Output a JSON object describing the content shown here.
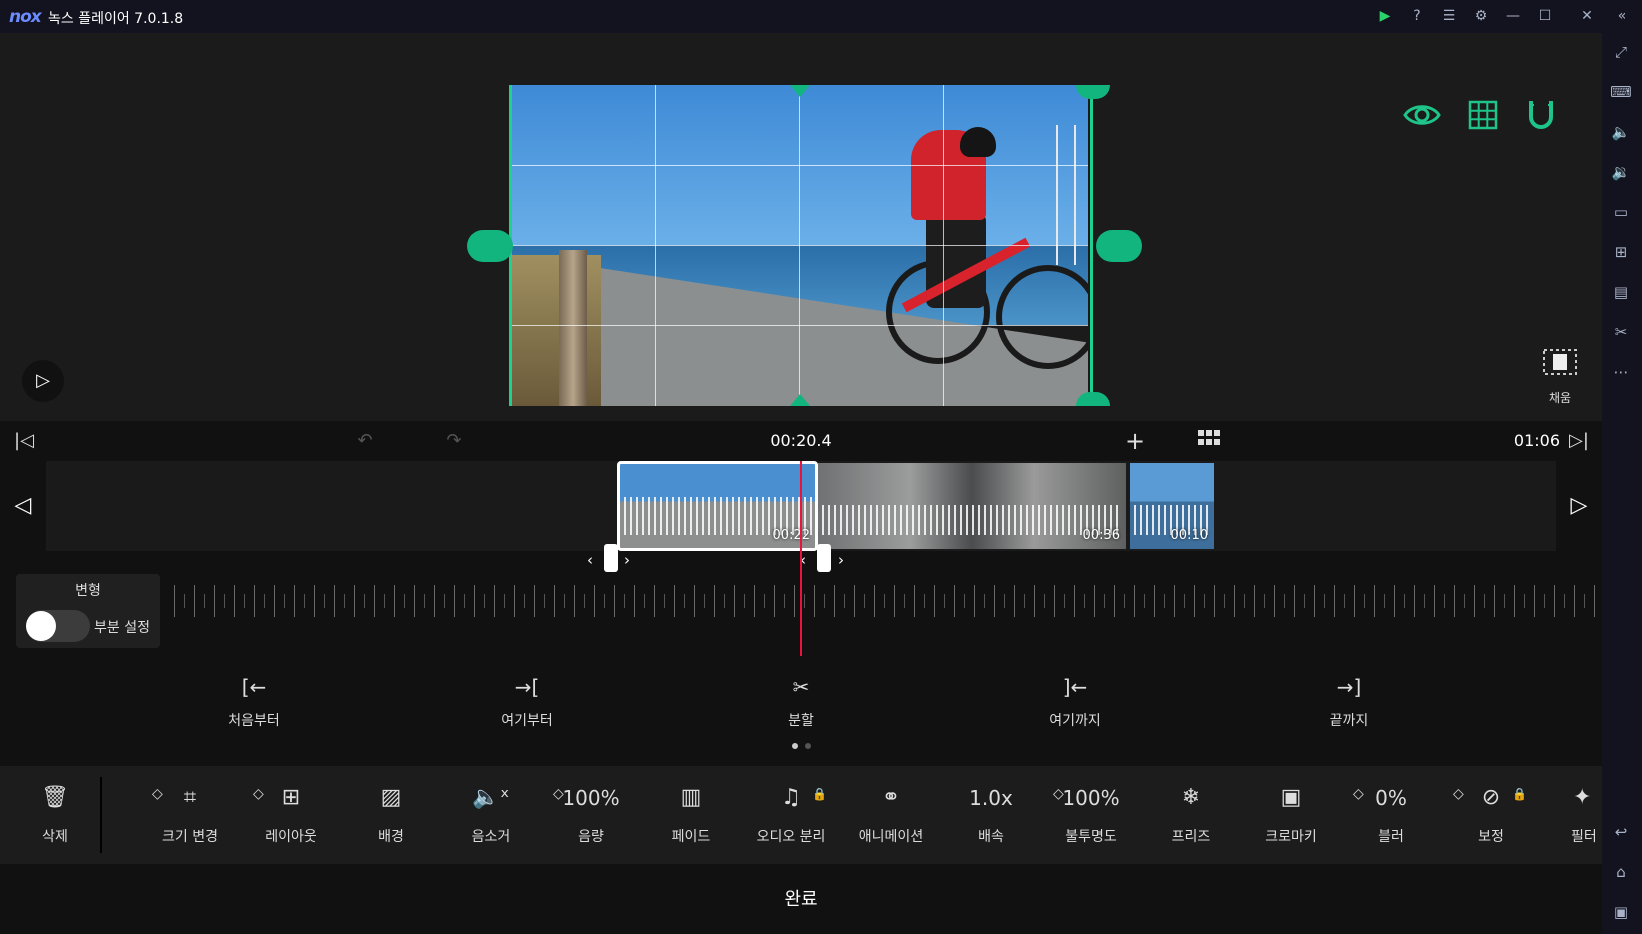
{
  "window": {
    "logo": "nox",
    "title": "녹스 플레이어 7.0.1.8"
  },
  "preview": {
    "fill_label": "채움"
  },
  "transport": {
    "current_time": "00:20.4",
    "total_time": "01:06"
  },
  "timeline": {
    "clips": [
      {
        "duration": "00:22"
      },
      {
        "duration": "00:36"
      },
      {
        "duration": "00:10"
      }
    ]
  },
  "transform": {
    "title": "변형",
    "toggle_label": "부분 설정"
  },
  "split_actions": [
    {
      "label": "처음부터",
      "icon": "trim-from-start-icon"
    },
    {
      "label": "여기부터",
      "icon": "trim-from-here-icon"
    },
    {
      "label": "분할",
      "icon": "scissors-icon"
    },
    {
      "label": "여기까지",
      "icon": "trim-to-here-icon"
    },
    {
      "label": "끝까지",
      "icon": "trim-to-end-icon"
    }
  ],
  "toolbar": {
    "delete_label": "삭제",
    "tools": [
      {
        "label": "크기 변경",
        "icon": "crop-icon"
      },
      {
        "label": "레이아웃",
        "icon": "layout-icon"
      },
      {
        "label": "배경",
        "icon": "background-icon"
      },
      {
        "label": "음소거",
        "icon": "mute-icon"
      },
      {
        "label": "음량",
        "value": "100%"
      },
      {
        "label": "페이드",
        "icon": "fade-icon"
      },
      {
        "label": "오디오 분리",
        "icon": "audio-split-icon"
      },
      {
        "label": "애니메이션",
        "icon": "animation-icon"
      },
      {
        "label": "배속",
        "value": "1.0x"
      },
      {
        "label": "불투명도",
        "value": "100%"
      },
      {
        "label": "프리즈",
        "icon": "snowflake-icon"
      },
      {
        "label": "크로마키",
        "icon": "chroma-key-icon"
      },
      {
        "label": "블러",
        "value": "0%"
      },
      {
        "label": "보정",
        "icon": "adjust-icon"
      },
      {
        "label": "필터",
        "icon": "filter-icon"
      }
    ]
  },
  "done_label": "완료",
  "colors": {
    "accent_green": "#1fd08f",
    "playhead_red": "#e8143c",
    "lock_red": "#e8143c"
  }
}
